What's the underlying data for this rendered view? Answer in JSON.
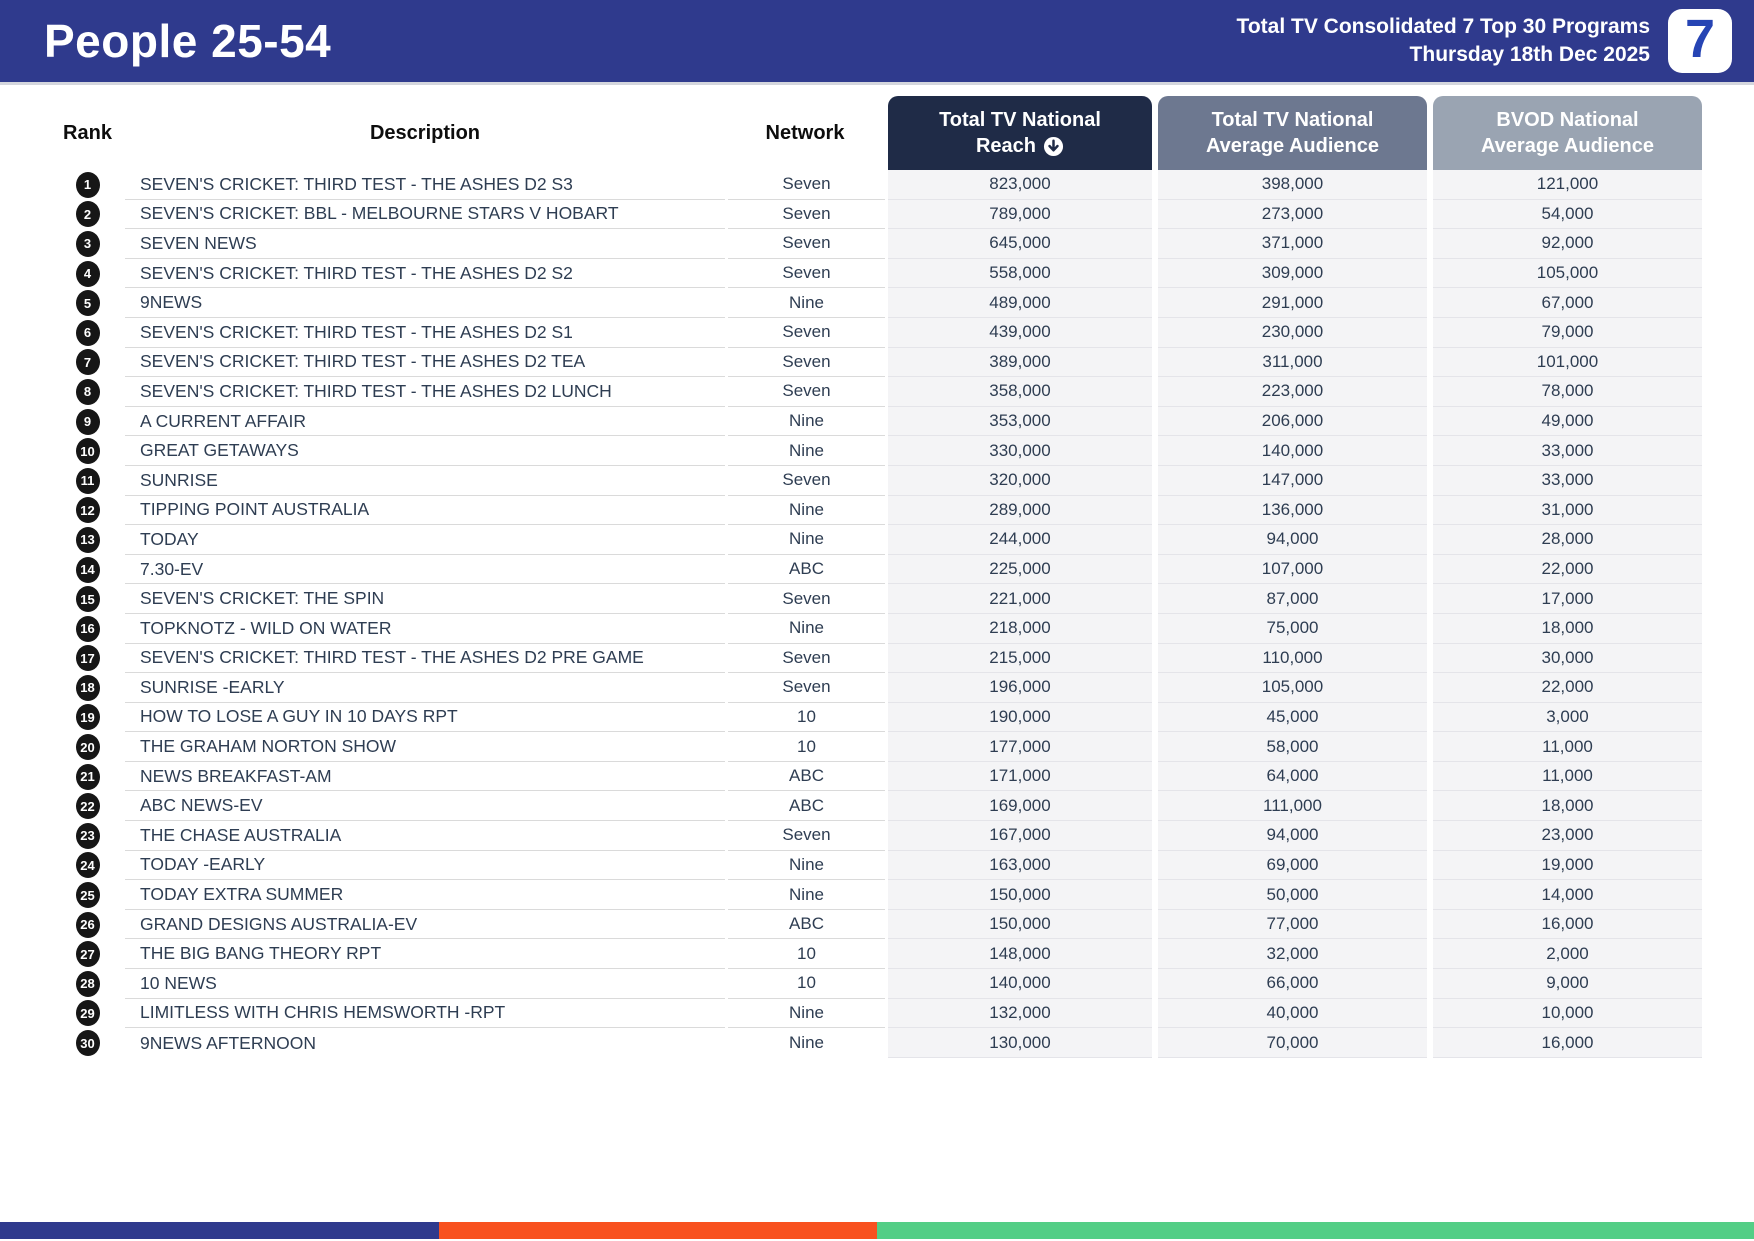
{
  "header": {
    "title": "People 25-54",
    "subtitle_line1": "Total TV Consolidated 7 Top 30 Programs",
    "subtitle_line2": "Thursday 18th Dec 2025",
    "logo_text": "7"
  },
  "table": {
    "columns": {
      "rank": "Rank",
      "description": "Description",
      "network": "Network",
      "reach": {
        "line1": "Total TV National",
        "line2": "Reach",
        "sort_icon": "circled-down-arrow",
        "sort": "descending"
      },
      "avg": {
        "line1": "Total TV National",
        "line2": "Average Audience"
      },
      "bvod": {
        "line1": "BVOD National",
        "line2": "Average Audience"
      }
    },
    "rows": [
      {
        "rank": 1,
        "description": "SEVEN'S CRICKET: THIRD TEST - THE ASHES D2 S3",
        "network": "Seven",
        "reach": "823,000",
        "avg": "398,000",
        "bvod": "121,000"
      },
      {
        "rank": 2,
        "description": "SEVEN'S CRICKET: BBL - MELBOURNE STARS V HOBART",
        "network": "Seven",
        "reach": "789,000",
        "avg": "273,000",
        "bvod": "54,000"
      },
      {
        "rank": 3,
        "description": "SEVEN NEWS",
        "network": "Seven",
        "reach": "645,000",
        "avg": "371,000",
        "bvod": "92,000"
      },
      {
        "rank": 4,
        "description": "SEVEN'S CRICKET: THIRD TEST - THE ASHES D2 S2",
        "network": "Seven",
        "reach": "558,000",
        "avg": "309,000",
        "bvod": "105,000"
      },
      {
        "rank": 5,
        "description": "9NEWS",
        "network": "Nine",
        "reach": "489,000",
        "avg": "291,000",
        "bvod": "67,000"
      },
      {
        "rank": 6,
        "description": "SEVEN'S CRICKET: THIRD TEST - THE ASHES D2 S1",
        "network": "Seven",
        "reach": "439,000",
        "avg": "230,000",
        "bvod": "79,000"
      },
      {
        "rank": 7,
        "description": "SEVEN'S CRICKET: THIRD TEST - THE ASHES D2 TEA",
        "network": "Seven",
        "reach": "389,000",
        "avg": "311,000",
        "bvod": "101,000"
      },
      {
        "rank": 8,
        "description": "SEVEN'S CRICKET: THIRD TEST - THE ASHES D2 LUNCH",
        "network": "Seven",
        "reach": "358,000",
        "avg": "223,000",
        "bvod": "78,000"
      },
      {
        "rank": 9,
        "description": "A CURRENT AFFAIR",
        "network": "Nine",
        "reach": "353,000",
        "avg": "206,000",
        "bvod": "49,000"
      },
      {
        "rank": 10,
        "description": "GREAT GETAWAYS",
        "network": "Nine",
        "reach": "330,000",
        "avg": "140,000",
        "bvod": "33,000"
      },
      {
        "rank": 11,
        "description": "SUNRISE",
        "network": "Seven",
        "reach": "320,000",
        "avg": "147,000",
        "bvod": "33,000"
      },
      {
        "rank": 12,
        "description": "TIPPING POINT AUSTRALIA",
        "network": "Nine",
        "reach": "289,000",
        "avg": "136,000",
        "bvod": "31,000"
      },
      {
        "rank": 13,
        "description": "TODAY",
        "network": "Nine",
        "reach": "244,000",
        "avg": "94,000",
        "bvod": "28,000"
      },
      {
        "rank": 14,
        "description": "7.30-EV",
        "network": "ABC",
        "reach": "225,000",
        "avg": "107,000",
        "bvod": "22,000"
      },
      {
        "rank": 15,
        "description": "SEVEN'S CRICKET: THE SPIN",
        "network": "Seven",
        "reach": "221,000",
        "avg": "87,000",
        "bvod": "17,000"
      },
      {
        "rank": 16,
        "description": "TOPKNOTZ - WILD ON WATER",
        "network": "Nine",
        "reach": "218,000",
        "avg": "75,000",
        "bvod": "18,000"
      },
      {
        "rank": 17,
        "description": "SEVEN'S CRICKET: THIRD TEST - THE ASHES D2 PRE GAME",
        "network": "Seven",
        "reach": "215,000",
        "avg": "110,000",
        "bvod": "30,000"
      },
      {
        "rank": 18,
        "description": "SUNRISE -EARLY",
        "network": "Seven",
        "reach": "196,000",
        "avg": "105,000",
        "bvod": "22,000"
      },
      {
        "rank": 19,
        "description": "HOW TO LOSE A GUY IN 10 DAYS RPT",
        "network": "10",
        "reach": "190,000",
        "avg": "45,000",
        "bvod": "3,000"
      },
      {
        "rank": 20,
        "description": "THE GRAHAM NORTON SHOW",
        "network": "10",
        "reach": "177,000",
        "avg": "58,000",
        "bvod": "11,000"
      },
      {
        "rank": 21,
        "description": "NEWS BREAKFAST-AM",
        "network": "ABC",
        "reach": "171,000",
        "avg": "64,000",
        "bvod": "11,000"
      },
      {
        "rank": 22,
        "description": "ABC NEWS-EV",
        "network": "ABC",
        "reach": "169,000",
        "avg": "111,000",
        "bvod": "18,000"
      },
      {
        "rank": 23,
        "description": "THE CHASE AUSTRALIA",
        "network": "Seven",
        "reach": "167,000",
        "avg": "94,000",
        "bvod": "23,000"
      },
      {
        "rank": 24,
        "description": "TODAY -EARLY",
        "network": "Nine",
        "reach": "163,000",
        "avg": "69,000",
        "bvod": "19,000"
      },
      {
        "rank": 25,
        "description": "TODAY EXTRA SUMMER",
        "network": "Nine",
        "reach": "150,000",
        "avg": "50,000",
        "bvod": "14,000"
      },
      {
        "rank": 26,
        "description": "GRAND DESIGNS AUSTRALIA-EV",
        "network": "ABC",
        "reach": "150,000",
        "avg": "77,000",
        "bvod": "16,000"
      },
      {
        "rank": 27,
        "description": "THE BIG BANG THEORY RPT",
        "network": "10",
        "reach": "148,000",
        "avg": "32,000",
        "bvod": "2,000"
      },
      {
        "rank": 28,
        "description": "10 NEWS",
        "network": "10",
        "reach": "140,000",
        "avg": "66,000",
        "bvod": "9,000"
      },
      {
        "rank": 29,
        "description": "LIMITLESS WITH CHRIS HEMSWORTH -RPT",
        "network": "Nine",
        "reach": "132,000",
        "avg": "40,000",
        "bvod": "10,000"
      },
      {
        "rank": 30,
        "description": "9NEWS AFTERNOON",
        "network": "Nine",
        "reach": "130,000",
        "avg": "70,000",
        "bvod": "16,000"
      }
    ]
  },
  "colors": {
    "banner_bg": "#2f3a8d",
    "reach_header_bg": "#1f2b47",
    "avg_header_bg": "#6d7890",
    "bvod_header_bg": "#9aa4b2",
    "numeric_cell_bg": "#f4f4f6",
    "footer_blue": "#2f3a8d",
    "footer_orange": "#f8511f",
    "footer_green": "#53ce86"
  }
}
